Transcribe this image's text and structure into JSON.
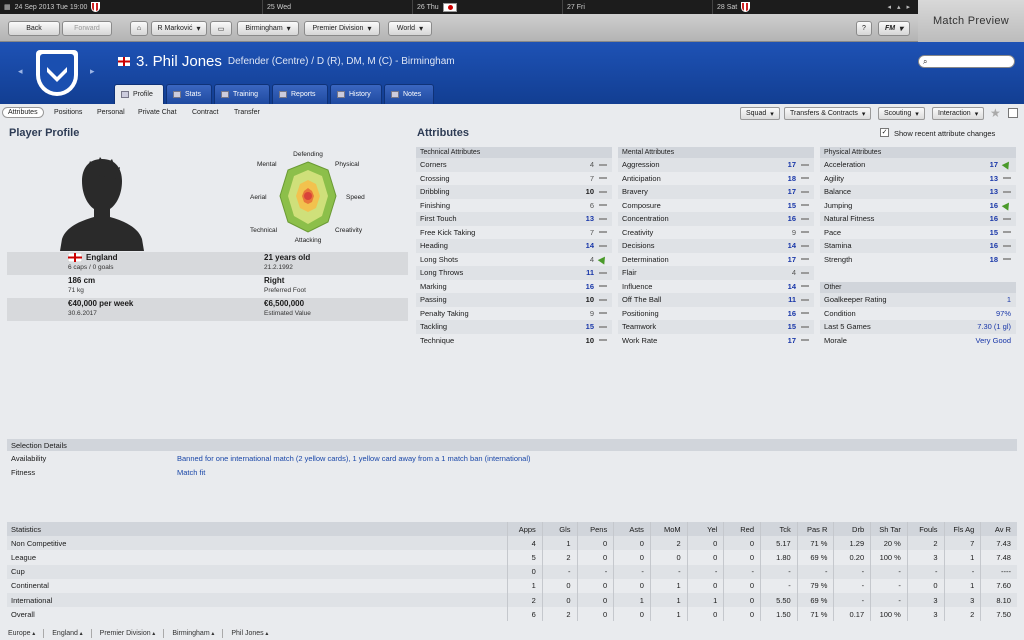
{
  "calendar": {
    "days": [
      {
        "label": "24 Sep 2013  Tue 19:00",
        "icon": "birmingham-crest"
      },
      {
        "label": "25 Wed",
        "icon": ""
      },
      {
        "label": "26 Thu",
        "icon": "japan-flag"
      },
      {
        "label": "27 Fri",
        "icon": ""
      },
      {
        "label": "28 Sat",
        "icon": "birmingham-crest"
      }
    ]
  },
  "match_preview": "Match Preview",
  "toolbar": {
    "back": "Back",
    "forward": "Forward",
    "manager": "R Marković",
    "club": "Birmingham",
    "league": "Premier Division",
    "world": "World",
    "help": "?",
    "fm": "FM"
  },
  "player": {
    "name": "3. Phil Jones",
    "position": "Defender (Centre) / D (R), DM, M (C) - Birmingham"
  },
  "tabs": [
    "Profile",
    "Stats",
    "Training",
    "Reports",
    "History",
    "Notes"
  ],
  "subnav": [
    "Attributes",
    "Positions",
    "Personal",
    "Private Chat",
    "Contract",
    "Transfer"
  ],
  "actions": [
    "Squad",
    "Transfers & Contracts",
    "Scouting",
    "Interaction"
  ],
  "profile": {
    "title": "Player Profile",
    "spider_labels": [
      "Defending",
      "Physical",
      "Speed",
      "Creativity",
      "Attacking",
      "Technical",
      "Aerial",
      "Mental"
    ],
    "nation": "England",
    "caps": "6 caps / 0 goals",
    "age": "21 years old",
    "dob": "21.2.1992",
    "height": "186 cm",
    "weight": "71 kg",
    "foot": "Right",
    "foot_label": "Preferred Foot",
    "wage": "€40,000 per week",
    "contract": "30.6.2017",
    "value": "€6,500,000",
    "value_label": "Estimated Value"
  },
  "attributes": {
    "title": "Attributes",
    "show_recent": "Show recent attribute changes",
    "technical": {
      "header": "Technical Attributes",
      "rows": [
        {
          "name": "Corners",
          "value": "4",
          "trend": "flat",
          "style": "lo"
        },
        {
          "name": "Crossing",
          "value": "7",
          "trend": "flat",
          "style": "lo"
        },
        {
          "name": "Dribbling",
          "value": "10",
          "trend": "flat",
          "style": ""
        },
        {
          "name": "Finishing",
          "value": "6",
          "trend": "flat",
          "style": "lo"
        },
        {
          "name": "First Touch",
          "value": "13",
          "trend": "flat",
          "style": "hi"
        },
        {
          "name": "Free Kick Taking",
          "value": "7",
          "trend": "flat",
          "style": "lo"
        },
        {
          "name": "Heading",
          "value": "14",
          "trend": "flat",
          "style": "hi"
        },
        {
          "name": "Long Shots",
          "value": "4",
          "trend": "up",
          "style": "lo"
        },
        {
          "name": "Long Throws",
          "value": "11",
          "trend": "flat",
          "style": "hi"
        },
        {
          "name": "Marking",
          "value": "16",
          "trend": "flat",
          "style": "hi"
        },
        {
          "name": "Passing",
          "value": "10",
          "trend": "flat",
          "style": ""
        },
        {
          "name": "Penalty Taking",
          "value": "9",
          "trend": "flat",
          "style": "lo"
        },
        {
          "name": "Tackling",
          "value": "15",
          "trend": "flat",
          "style": "hi"
        },
        {
          "name": "Technique",
          "value": "10",
          "trend": "flat",
          "style": ""
        }
      ]
    },
    "mental": {
      "header": "Mental Attributes",
      "rows": [
        {
          "name": "Aggression",
          "value": "17",
          "trend": "flat",
          "style": "hi"
        },
        {
          "name": "Anticipation",
          "value": "18",
          "trend": "flat",
          "style": "hi"
        },
        {
          "name": "Bravery",
          "value": "17",
          "trend": "flat",
          "style": "hi"
        },
        {
          "name": "Composure",
          "value": "15",
          "trend": "flat",
          "style": "hi"
        },
        {
          "name": "Concentration",
          "value": "16",
          "trend": "flat",
          "style": "hi"
        },
        {
          "name": "Creativity",
          "value": "9",
          "trend": "flat",
          "style": "lo"
        },
        {
          "name": "Decisions",
          "value": "14",
          "trend": "flat",
          "style": "hi"
        },
        {
          "name": "Determination",
          "value": "17",
          "trend": "flat",
          "style": "hi"
        },
        {
          "name": "Flair",
          "value": "4",
          "trend": "flat",
          "style": "lo"
        },
        {
          "name": "Influence",
          "value": "14",
          "trend": "flat",
          "style": "hi"
        },
        {
          "name": "Off The Ball",
          "value": "11",
          "trend": "flat",
          "style": "hi"
        },
        {
          "name": "Positioning",
          "value": "16",
          "trend": "flat",
          "style": "hi"
        },
        {
          "name": "Teamwork",
          "value": "15",
          "trend": "flat",
          "style": "hi"
        },
        {
          "name": "Work Rate",
          "value": "17",
          "trend": "flat",
          "style": "hi"
        }
      ]
    },
    "physical": {
      "header": "Physical Attributes",
      "rows": [
        {
          "name": "Acceleration",
          "value": "17",
          "trend": "up",
          "style": "hi"
        },
        {
          "name": "Agility",
          "value": "13",
          "trend": "flat",
          "style": "hi"
        },
        {
          "name": "Balance",
          "value": "13",
          "trend": "flat",
          "style": "hi"
        },
        {
          "name": "Jumping",
          "value": "16",
          "trend": "up",
          "style": "hi"
        },
        {
          "name": "Natural Fitness",
          "value": "16",
          "trend": "flat",
          "style": "hi"
        },
        {
          "name": "Pace",
          "value": "15",
          "trend": "flat",
          "style": "hi"
        },
        {
          "name": "Stamina",
          "value": "16",
          "trend": "flat",
          "style": "hi"
        },
        {
          "name": "Strength",
          "value": "18",
          "trend": "flat",
          "style": "hi"
        }
      ]
    },
    "other": {
      "header": "Other",
      "rows": [
        {
          "name": "Goalkeeper Rating",
          "value": "1"
        },
        {
          "name": "Condition",
          "value": "97%"
        },
        {
          "name": "Last 5 Games",
          "value": "7.30 (1 gl)"
        },
        {
          "name": "Morale",
          "value": "Very Good"
        }
      ]
    }
  },
  "selection": {
    "header": "Selection Details",
    "availability_label": "Availability",
    "availability": "Banned for one international match (2 yellow cards), 1 yellow card away from a 1 match ban (international)",
    "fitness_label": "Fitness",
    "fitness": "Match fit"
  },
  "statistics": {
    "columns": [
      "Statistics",
      "Apps",
      "Gls",
      "Pens",
      "Asts",
      "MoM",
      "Yel",
      "Red",
      "Tck",
      "Pas R",
      "Drb",
      "Sh Tar",
      "Fouls",
      "Fls Ag",
      "Av R"
    ],
    "rows": [
      [
        "Non Competitive",
        "4",
        "1",
        "0",
        "0",
        "2",
        "0",
        "0",
        "5.17",
        "71 %",
        "1.29",
        "20 %",
        "2",
        "7",
        "7.43"
      ],
      [
        "League",
        "5",
        "2",
        "0",
        "0",
        "0",
        "0",
        "0",
        "1.80",
        "69 %",
        "0.20",
        "100 %",
        "3",
        "1",
        "7.48"
      ],
      [
        "Cup",
        "0",
        "-",
        "-",
        "-",
        "-",
        "-",
        "-",
        "-",
        "-",
        "-",
        "-",
        "-",
        "-",
        "----"
      ],
      [
        "Continental",
        "1",
        "0",
        "0",
        "0",
        "1",
        "0",
        "0",
        "-",
        "79 %",
        "-",
        "-",
        "0",
        "1",
        "7.60"
      ],
      [
        "International",
        "2",
        "0",
        "0",
        "1",
        "1",
        "1",
        "0",
        "5.50",
        "69 %",
        "-",
        "-",
        "3",
        "3",
        "8.10"
      ],
      [
        "Overall",
        "6",
        "2",
        "0",
        "0",
        "1",
        "0",
        "0",
        "1.50",
        "71 %",
        "0.17",
        "100 %",
        "3",
        "2",
        "7.50"
      ]
    ]
  },
  "breadcrumb": [
    "Europe",
    "England",
    "Premier Division",
    "Birmingham",
    "Phil Jones"
  ]
}
